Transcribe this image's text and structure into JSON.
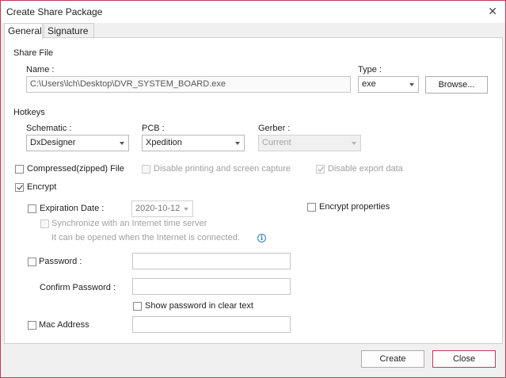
{
  "window": {
    "title": "Create Share Package",
    "close_glyph": "✕"
  },
  "tabs": [
    {
      "label": "General",
      "active": true
    },
    {
      "label": "Signature",
      "active": false
    }
  ],
  "share_file": {
    "section_label": "Share File",
    "name_label": "Name :",
    "name_value": "C:\\Users\\lch\\Desktop\\DVR_SYSTEM_BOARD.exe",
    "type_label": "Type :",
    "type_value": "exe",
    "browse_label": "Browse..."
  },
  "hotkeys": {
    "section_label": "Hotkeys",
    "schematic_label": "Schematic :",
    "schematic_value": "DxDesigner",
    "pcb_label": "PCB :",
    "pcb_value": "Xpedition",
    "gerber_label": "Gerber :",
    "gerber_value": "Current"
  },
  "options": {
    "compressed_label": "Compressed(zipped) File",
    "compressed_checked": false,
    "disable_printing_label": "Disable printing and screen capture",
    "disable_printing_checked": false,
    "disable_export_label": "Disable export data",
    "disable_export_checked": true,
    "encrypt_label": "Encrypt",
    "encrypt_checked": true
  },
  "encrypt": {
    "expiration_label": "Expiration Date :",
    "expiration_checked": false,
    "expiration_value": "2020-10-12",
    "encrypt_properties_label": "Encrypt properties",
    "encrypt_properties_checked": false,
    "sync_label": "Synchronize with an Internet time server",
    "sync_checked": false,
    "internet_note": "It can be opened when the Internet is connected.",
    "info_glyph": "i",
    "password_label": "Password :",
    "password_checked": false,
    "password_value": "",
    "confirm_label": "Confirm Password :",
    "confirm_value": "",
    "show_password_label": "Show password in clear text",
    "show_password_checked": false,
    "mac_label": "Mac Address",
    "mac_checked": false,
    "mac_value": ""
  },
  "footer": {
    "create_label": "Create",
    "close_label": "Close"
  },
  "colors": {
    "accent_border": "#c0395a",
    "info_blue": "#2b7bd6"
  }
}
